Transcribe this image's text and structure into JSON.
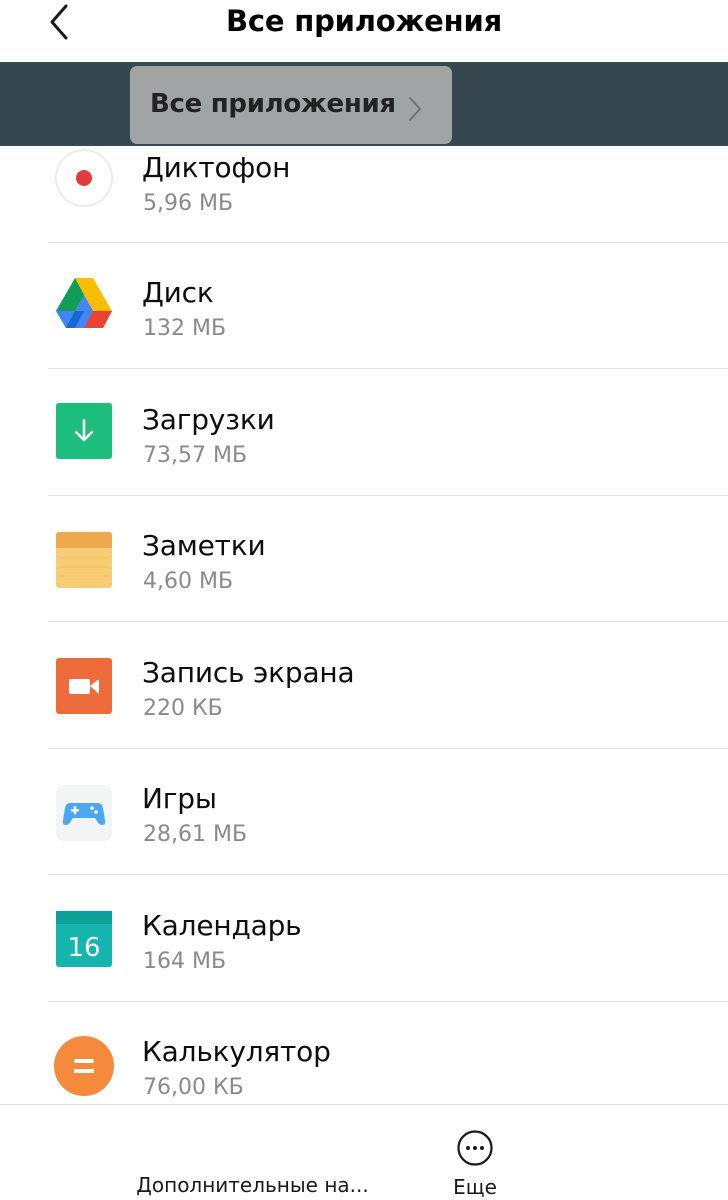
{
  "header": {
    "title": "Все приложения",
    "back_icon": "back-arrow-icon"
  },
  "filter": {
    "label": "Все приложения",
    "chevron_icon": "chevron-right-icon"
  },
  "apps": [
    {
      "name": "Диктофон",
      "size": "5,96 МБ",
      "icon": "recorder-icon"
    },
    {
      "name": "Диск",
      "size": "132 МБ",
      "icon": "drive-icon"
    },
    {
      "name": "Загрузки",
      "size": "73,57 МБ",
      "icon": "downloads-icon"
    },
    {
      "name": "Заметки",
      "size": "4,60 МБ",
      "icon": "notes-icon"
    },
    {
      "name": "Запись экрана",
      "size": "220 КБ",
      "icon": "screen-recorder-icon"
    },
    {
      "name": "Игры",
      "size": "28,61 МБ",
      "icon": "games-icon"
    },
    {
      "name": "Календарь",
      "size": "164 МБ",
      "icon": "calendar-icon",
      "icon_text": "16"
    },
    {
      "name": "Калькулятор",
      "size": "76,00 КБ",
      "icon": "calculator-icon"
    }
  ],
  "bottom": {
    "settings_label": "Дополнительные на...",
    "more_label": "Еще",
    "more_icon": "more-dots-icon"
  },
  "colors": {
    "filter_bar": "#37474f",
    "filter_chip": "#a0a4a5",
    "recorder_dot": "#e03c3c",
    "downloads": "#1dbd7d",
    "notes": "#f6cd74",
    "screen_recorder": "#ee6b3b",
    "games": "#4aa8f0",
    "calendar": "#14b5ae",
    "calculator": "#f58a3c"
  }
}
